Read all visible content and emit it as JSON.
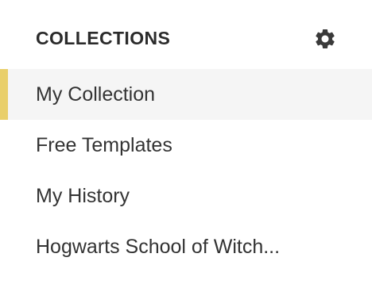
{
  "collections": {
    "title": "COLLECTIONS",
    "settings_icon": "gear-icon",
    "items": [
      {
        "label": "My Collection",
        "active": true
      },
      {
        "label": "Free Templates",
        "active": false
      },
      {
        "label": "My History",
        "active": false
      },
      {
        "label": "Hogwarts School of Witch...",
        "active": false
      }
    ]
  },
  "colors": {
    "accent": "#e9cf6a",
    "active_row": "#f5f5f5",
    "text": "#333333",
    "icon": "#3a3a3a"
  }
}
